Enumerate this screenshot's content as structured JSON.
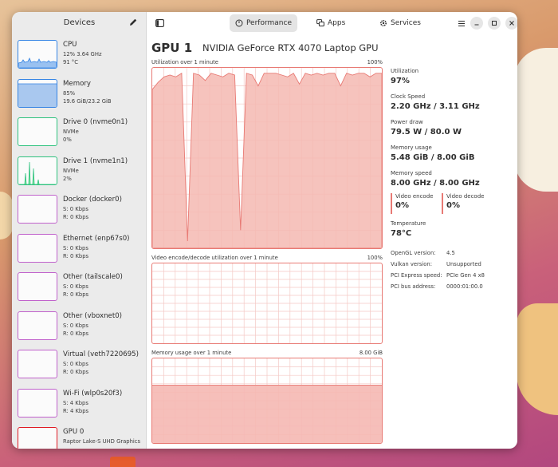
{
  "sidebar": {
    "title": "Devices",
    "devices": [
      {
        "name": "CPU",
        "line1": "12% 3.64 GHz",
        "line2": "91 °C",
        "color": "#3584e4"
      },
      {
        "name": "Memory",
        "line1": "85%",
        "line2": "19.6 GiB/23.2 GiB",
        "color": "#3584e4"
      },
      {
        "name": "Drive 0 (nvme0n1)",
        "line1": "NVMe",
        "line2": "0%",
        "color": "#2ec27e"
      },
      {
        "name": "Drive 1 (nvme1n1)",
        "line1": "NVMe",
        "line2": "2%",
        "color": "#2ec27e"
      },
      {
        "name": "Docker (docker0)",
        "line1": "S: 0 Kbps",
        "line2": "R: 0 Kbps",
        "color": "#c061cb"
      },
      {
        "name": "Ethernet (enp67s0)",
        "line1": "S: 0 Kbps",
        "line2": "R: 0 Kbps",
        "color": "#c061cb"
      },
      {
        "name": "Other (tailscale0)",
        "line1": "S: 0 Kbps",
        "line2": "R: 0 Kbps",
        "color": "#c061cb"
      },
      {
        "name": "Other (vboxnet0)",
        "line1": "S: 0 Kbps",
        "line2": "R: 0 Kbps",
        "color": "#c061cb"
      },
      {
        "name": "Virtual (veth7220695)",
        "line1": "S: 0 Kbps",
        "line2": "R: 0 Kbps",
        "color": "#c061cb"
      },
      {
        "name": "Wi-Fi (wlp0s20f3)",
        "line1": "S: 4 Kbps",
        "line2": "R: 4 Kbps",
        "color": "#c061cb"
      },
      {
        "name": "GPU 0",
        "line1": "Raptor Lake-S UHD Graphics",
        "line2": "",
        "color": "#e01b24"
      }
    ]
  },
  "tabs": [
    {
      "label": "Performance",
      "icon": "gauge-icon",
      "active": true
    },
    {
      "label": "Apps",
      "icon": "apps-icon",
      "active": false
    },
    {
      "label": "Services",
      "icon": "gear-icon",
      "active": false
    }
  ],
  "gpu": {
    "title": "GPU 1",
    "model": "NVIDIA GeForce RTX 4070 Laptop GPU",
    "graphs": {
      "utilization": {
        "label": "Utilization over 1 minute",
        "max": "100%"
      },
      "video": {
        "label": "Video encode/decode utilization over 1 minute",
        "max": "100%"
      },
      "memory": {
        "label": "Memory usage over 1 minute",
        "max": "8.00 GiB"
      }
    },
    "stats": {
      "utilization": {
        "label": "Utilization",
        "value": "97%"
      },
      "clock_speed": {
        "label": "Clock Speed",
        "value": "2.20 GHz / 3.11 GHz"
      },
      "power_draw": {
        "label": "Power draw",
        "value": "79.5 W / 80.0 W"
      },
      "memory_usage": {
        "label": "Memory usage",
        "value": "5.48 GiB / 8.00 GiB"
      },
      "memory_speed": {
        "label": "Memory speed",
        "value": "8.00 GHz / 8.00 GHz"
      },
      "video_encode": {
        "label": "Video encode",
        "value": "0%"
      },
      "video_decode": {
        "label": "Video decode",
        "value": "0%"
      },
      "temperature": {
        "label": "Temperature",
        "value": "78°C"
      }
    },
    "info": [
      {
        "key": "OpenGL version:",
        "value": "4.5"
      },
      {
        "key": "Vulkan version:",
        "value": "Unsupported"
      },
      {
        "key": "PCI Express speed:",
        "value": "PCIe Gen 4 x8"
      },
      {
        "key": "PCI bus address:",
        "value": "0000:01:00.0"
      }
    ],
    "utilization_series": [
      88,
      92,
      95,
      96,
      95,
      97,
      4,
      97,
      96,
      93,
      97,
      96,
      95,
      97,
      96,
      10,
      97,
      96,
      90,
      97,
      97,
      97,
      96,
      95,
      97,
      91,
      97,
      96,
      97,
      96,
      97,
      97,
      90,
      97,
      96,
      97,
      97,
      95,
      97,
      97
    ],
    "memory_fraction": 0.685
  },
  "colors": {
    "accent": "#e87a74",
    "fill": "#f5b8b2",
    "grid": "#f4c9c5"
  }
}
